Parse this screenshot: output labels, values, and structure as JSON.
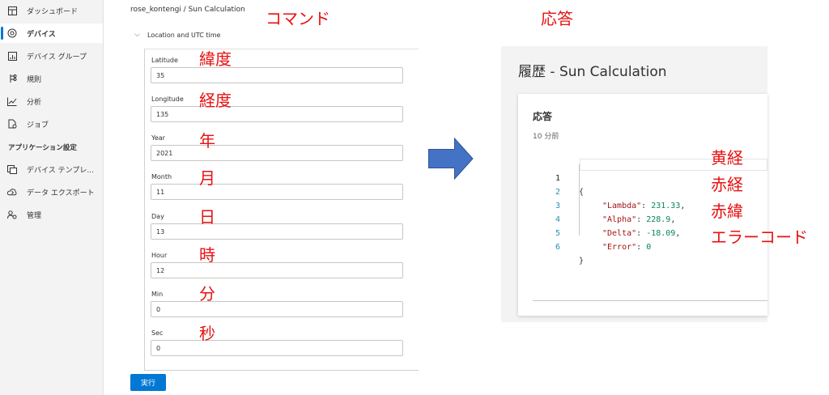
{
  "sidebar": {
    "items": [
      {
        "label": "ダッシュボード",
        "icon": "dashboard-icon"
      },
      {
        "label": "デバイス",
        "icon": "devices-icon",
        "active": true
      },
      {
        "label": "デバイス グループ",
        "icon": "device-groups-icon"
      },
      {
        "label": "規則",
        "icon": "rules-icon"
      },
      {
        "label": "分析",
        "icon": "analytics-icon"
      },
      {
        "label": "ジョブ",
        "icon": "jobs-icon"
      }
    ],
    "section_label": "アプリケーション設定",
    "settings_items": [
      {
        "label": "デバイス テンプレ...",
        "icon": "device-templates-icon"
      },
      {
        "label": "データ エクスポート",
        "icon": "data-export-icon"
      },
      {
        "label": "管理",
        "icon": "administration-icon"
      }
    ]
  },
  "command": {
    "title": "rose_kontengi / Sun Calculation",
    "section": "Location and UTC time",
    "fields": [
      {
        "label": "Latitude",
        "value": "35",
        "note": "緯度"
      },
      {
        "label": "Longitude",
        "value": "135",
        "note": "経度"
      },
      {
        "label": "Year",
        "value": "2021",
        "note": "年"
      },
      {
        "label": "Month",
        "value": "11",
        "note": "月"
      },
      {
        "label": "Day",
        "value": "13",
        "note": "日"
      },
      {
        "label": "Hour",
        "value": "12",
        "note": "時"
      },
      {
        "label": "Min",
        "value": "0",
        "note": "分"
      },
      {
        "label": "Sec",
        "value": "0",
        "note": "秒"
      }
    ],
    "run_label": "実行"
  },
  "annotations": {
    "command_heading": "コマンド",
    "response_heading": "応答",
    "result_notes": [
      "黄経",
      "赤経",
      "赤緯",
      "エラーコード"
    ]
  },
  "response": {
    "title": "履歴 - Sun Calculation",
    "heading": "応答",
    "time": "10 分前",
    "lines": [
      {
        "no": "1",
        "text": "{"
      },
      {
        "no": "2",
        "key": "\"Lambda\"",
        "value": "231.33",
        "trail": ","
      },
      {
        "no": "3",
        "key": "\"Alpha\"",
        "value": "228.9",
        "trail": ","
      },
      {
        "no": "4",
        "key": "\"Delta\"",
        "value": "-18.09",
        "trail": ","
      },
      {
        "no": "5",
        "key": "\"Error\"",
        "value": "0",
        "trail": ""
      },
      {
        "no": "6",
        "text": "}"
      }
    ]
  },
  "colors": {
    "annotation": "#e81010",
    "arrow": "#4472c4",
    "primary": "#0078d4"
  }
}
